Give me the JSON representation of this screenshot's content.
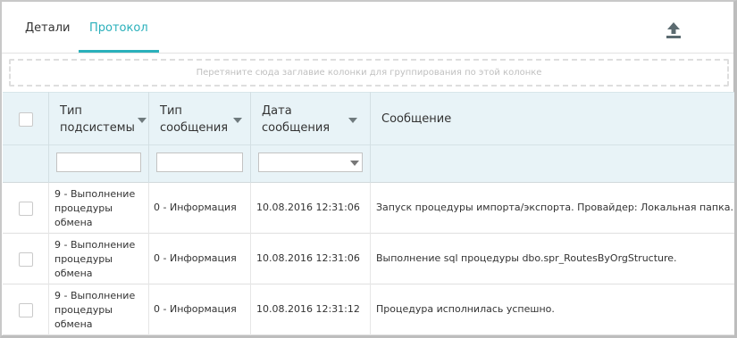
{
  "tabs": {
    "details": "Детали",
    "protocol": "Протокол",
    "active": "protocol"
  },
  "toolbar": {
    "grid_icon": "table-settings-icon",
    "export_icon": "upload-icon"
  },
  "group_zone": {
    "placeholder": "Перетяните сюда заглавие колонки для группирования по этой колонке"
  },
  "columns": {
    "subsystem": {
      "line1": "Тип",
      "line2": "подсистемы"
    },
    "message_type": {
      "line1": "Тип",
      "line2": "сообщения"
    },
    "date": {
      "line1": "Дата",
      "line2": "сообщения"
    },
    "message": {
      "line1": "Сообщение"
    }
  },
  "rows": [
    {
      "subsystem": {
        "l1": "9 - Выполнение",
        "l2": "процедуры",
        "l3": "обмена"
      },
      "message_type": "0 - Информация",
      "date": "10.08.2016 12:31:06",
      "message": "Запуск процедуры импорта/экспорта. Провайдер: Локальная папка."
    },
    {
      "subsystem": {
        "l1": "9 - Выполнение",
        "l2": "процедуры",
        "l3": "обмена"
      },
      "message_type": "0 - Информация",
      "date": "10.08.2016 12:31:06",
      "message": "Выполнение sql процедуры dbo.spr_RoutesByOrgStructure."
    },
    {
      "subsystem": {
        "l1": "9 - Выполнение",
        "l2": "процедуры",
        "l3": "обмена"
      },
      "message_type": "0 - Информация",
      "date": "10.08.2016 12:31:12",
      "message": "Процедура исполнилась успешно."
    }
  ],
  "colors": {
    "accent": "#2ab0bb",
    "header_bg": "#e8f3f7"
  }
}
